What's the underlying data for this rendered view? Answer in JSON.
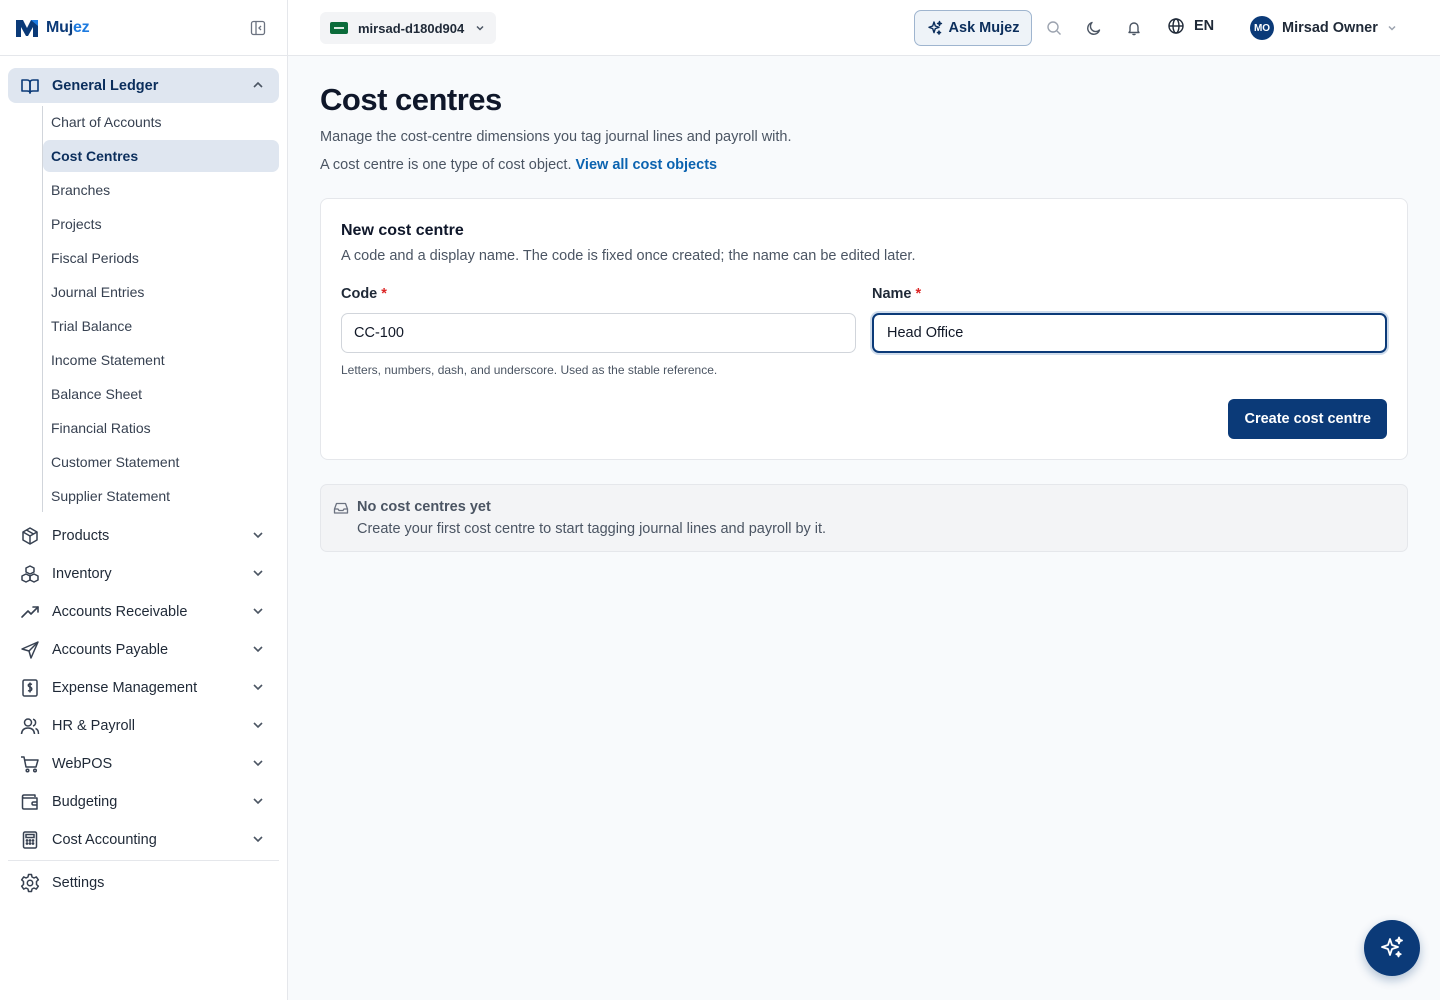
{
  "brand": {
    "name_a": "Muj",
    "name_b": "ez"
  },
  "nav": {
    "general_ledger": {
      "label": "General Ledger",
      "items": [
        "Chart of Accounts",
        "Cost Centres",
        "Branches",
        "Projects",
        "Fiscal Periods",
        "Journal Entries",
        "Trial Balance",
        "Income Statement",
        "Balance Sheet",
        "Financial Ratios",
        "Customer Statement",
        "Supplier Statement"
      ]
    },
    "groups": {
      "products": "Products",
      "inventory": "Inventory",
      "receivable": "Accounts Receivable",
      "payable": "Accounts Payable",
      "expense": "Expense Management",
      "hr": "HR & Payroll",
      "webpos": "WebPOS",
      "budgeting": "Budgeting",
      "cost_accounting": "Cost Accounting"
    },
    "settings": "Settings"
  },
  "topbar": {
    "tenant": "mirsad-d180d904",
    "ask": "Ask Mujez",
    "language": "EN",
    "avatar_initials": "MO",
    "user_name": "Mirsad Owner"
  },
  "page": {
    "title": "Cost centres",
    "description": "Manage the cost-centre dimensions you tag journal lines and payroll with.",
    "sub_text": "A cost centre is one type of cost object.",
    "sub_link": "View all cost objects"
  },
  "form": {
    "title": "New cost centre",
    "description": "A code and a display name. The code is fixed once created; the name can be edited later.",
    "code_label": "Code",
    "code_value": "CC-100",
    "code_hint": "Letters, numbers, dash, and underscore. Used as the stable reference.",
    "name_label": "Name",
    "name_value": "Head Office",
    "required_mark": "*",
    "submit": "Create cost centre"
  },
  "empty": {
    "title": "No cost centres yet",
    "description": "Create your first cost centre to start tagging journal lines and payroll by it."
  }
}
